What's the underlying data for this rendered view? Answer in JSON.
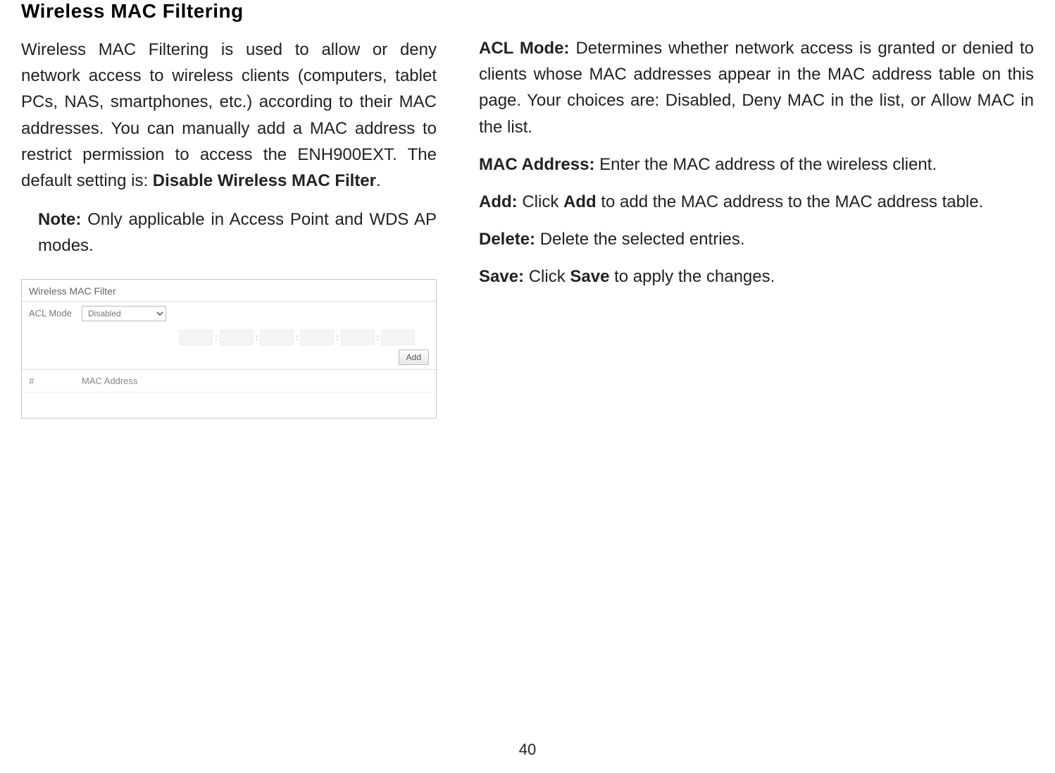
{
  "pageNumber": "40",
  "left": {
    "heading": "Wireless MAC Filtering",
    "paragraph": "Wireless MAC Filtering is used to allow or deny network access to wireless clients (computers, tablet PCs, NAS, smartphones, etc.) according to their MAC addresses. You can manually add a MAC address to restrict permission to access the ENH900EXT. The default setting is: ",
    "paragraphBold": "Disable Wireless MAC Filter",
    "paragraphEnd": ".",
    "noteLabel": "Note: ",
    "noteText": " Only applicable in Access Point and WDS AP modes.",
    "screenshot": {
      "title": "Wireless MAC Filter",
      "aclLabel": "ACL Mode",
      "aclValue": "Disabled",
      "addButton": "Add",
      "hashHeader": "#",
      "macHeader": "MAC Address"
    }
  },
  "right": {
    "defs": [
      {
        "label": "ACL Mode:",
        "text": " Determines whether network access is granted or denied to clients whose MAC addresses appear in the MAC address table on this page. Your choices are: Disabled, Deny MAC in the list, or Allow MAC in the list."
      },
      {
        "label": "MAC Address:",
        "text": " Enter the MAC address of the wireless client."
      },
      {
        "label": "Add:",
        "text1": " Click ",
        "bold": "Add",
        "text2": " to add the MAC address to the MAC address table."
      },
      {
        "label": "Delete:",
        "text": " Delete the selected entries."
      },
      {
        "label": "Save:",
        "text1": " Click ",
        "bold": "Save",
        "text2": " to apply the changes."
      }
    ]
  }
}
